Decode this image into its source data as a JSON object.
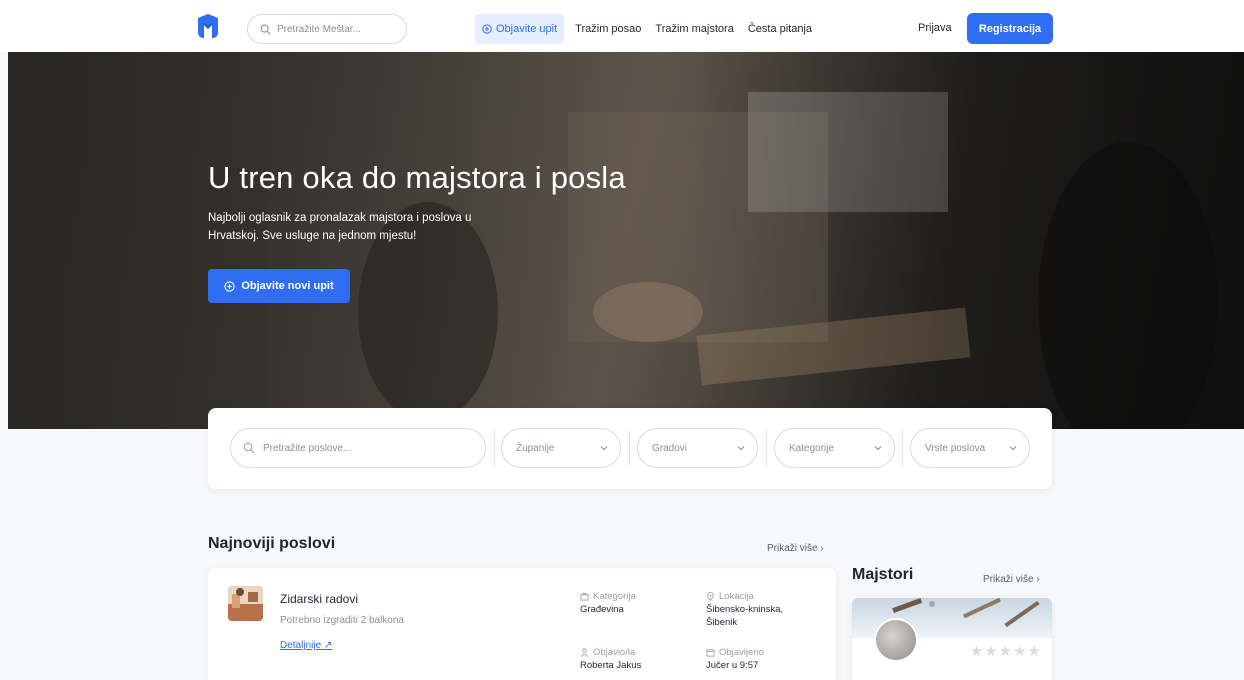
{
  "nav": {
    "search_placeholder": "Pretražite Meštar...",
    "links": [
      {
        "label": "Objavite upit",
        "icon": "plus-circle-icon",
        "primary": true
      },
      {
        "label": "Tražim posao"
      },
      {
        "label": "Tražim majstora"
      },
      {
        "label": "Česta pitanja"
      }
    ],
    "login": "Prijava",
    "register": "Registracija"
  },
  "hero": {
    "title": "U tren oka do majstora i posla",
    "subtitle": "Najbolji oglasnik za pronalazak majstora i poslova u Hrvatskoj. Sve usluge na jednom mjestu!",
    "cta": "Objavite novi upit"
  },
  "filters": {
    "search_placeholder": "Pretražite poslove...",
    "selects": [
      "Županije",
      "Gradovi",
      "Kategorije",
      "Vrste poslova"
    ]
  },
  "jobs": {
    "title": "Najnoviji poslovi",
    "more": "Prikaži više",
    "items": [
      {
        "title": "Zidarski radovi",
        "description": "Potrebno izgraditi 2 balkona",
        "details": "Detaljnije",
        "category_label": "Kategorija",
        "category": "Građevina",
        "location_label": "Lokacija",
        "location": "Šibensko-kninska, Šibenik",
        "author_label": "Objavio/la",
        "author": "Roberta Jakus",
        "published_label": "Objavljeno",
        "published": "Jučer u 9:57"
      }
    ]
  },
  "majstori": {
    "title": "Majstori",
    "more": "Prikaži više",
    "rating_stars": 5
  },
  "colors": {
    "accent": "#2f6df2",
    "accent_light": "#e6efff",
    "text": "#1f2430",
    "muted": "#8a8f99",
    "background": "#f7f8fa"
  }
}
